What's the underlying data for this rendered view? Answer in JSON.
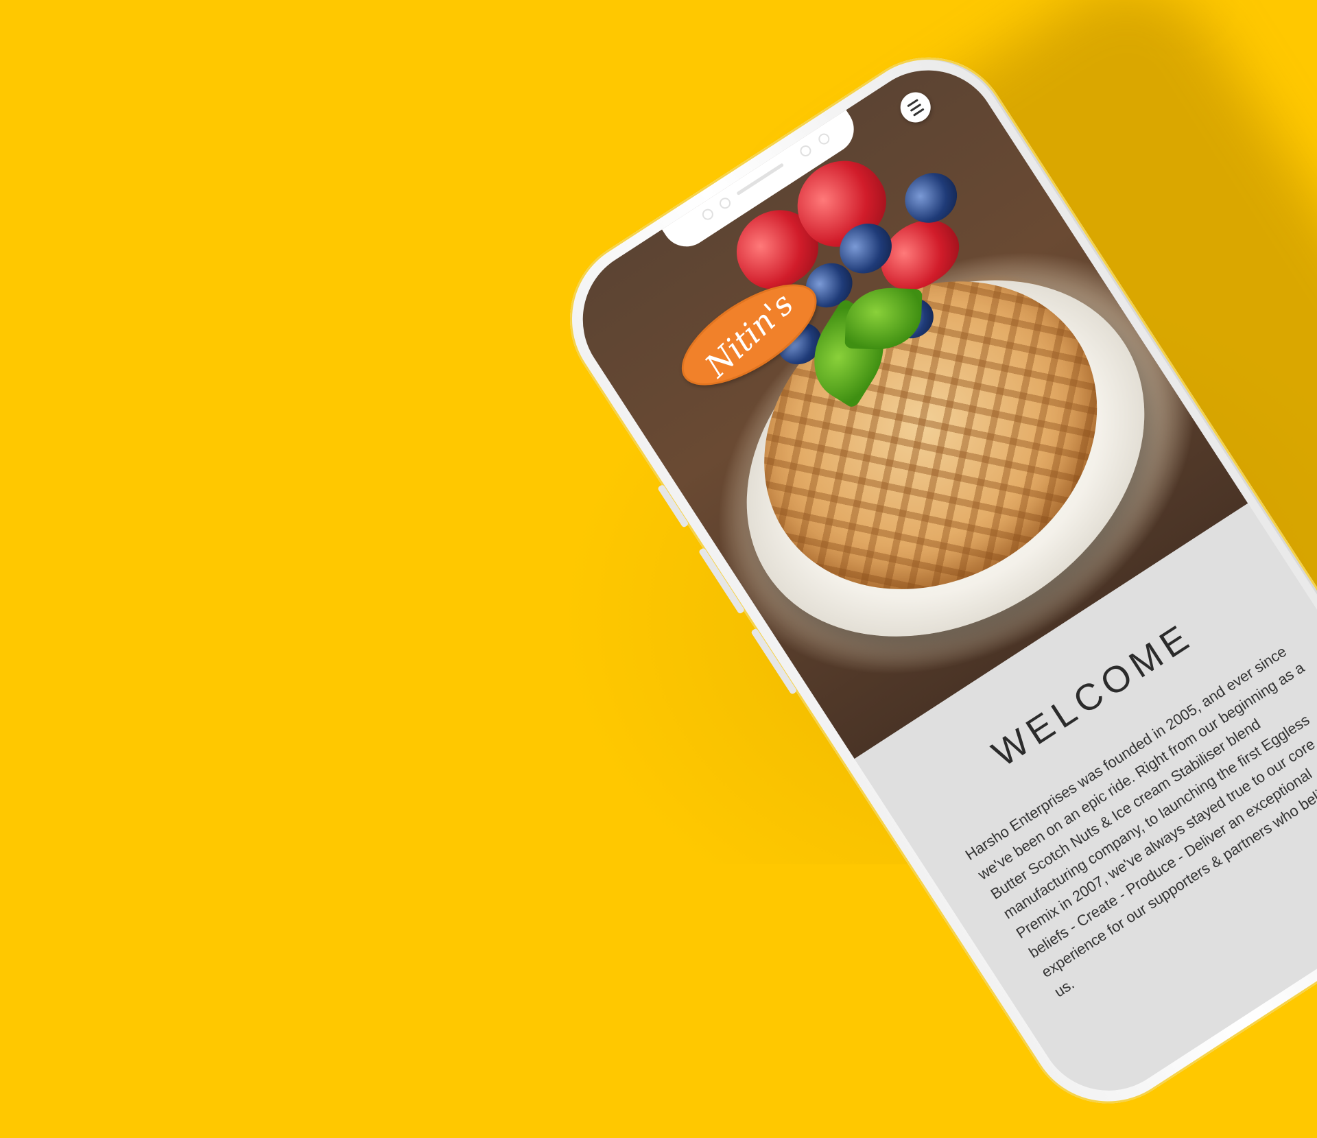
{
  "app": {
    "logo_text": "Nitin's"
  },
  "header": {
    "menu_icon": "hamburger-menu-icon"
  },
  "main": {
    "heading": "WELCOME",
    "paragraph": "Harsho Enterprises was founded in 2005, and ever since we've been on an epic ride. Right from our beginning as a Butter Scotch Nuts & Ice cream Stabiliser blend manufacturing company, to launching the first Eggless Premix in 2007, we've always stayed true to our core beliefs - Create - Produce - Deliver an exceptional experience for our supporters & partners who believe in us."
  },
  "colors": {
    "background": "#ffc800",
    "logo_badge": "#f1812a",
    "content_bg": "#dfdfdf"
  }
}
